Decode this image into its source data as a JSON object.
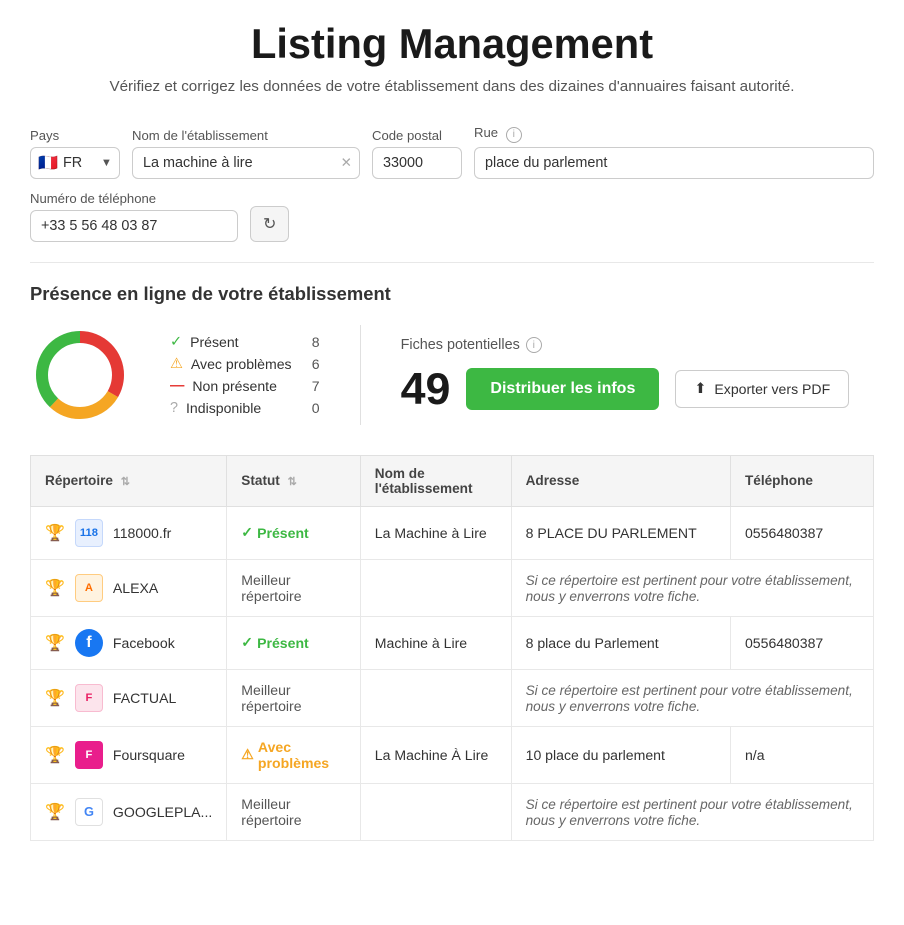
{
  "page": {
    "title": "Listing Management",
    "subtitle": "Vérifiez et corrigez les données de votre établissement dans des dizaines d'annuaires faisant autorité."
  },
  "filters": {
    "pays_label": "Pays",
    "pays_value": "FR",
    "pays_flag": "🇫🇷",
    "nom_label": "Nom de l'établissement",
    "nom_value": "La machine à lire",
    "code_postal_label": "Code postal",
    "code_postal_value": "33000",
    "rue_label": "Rue",
    "rue_info": "i",
    "rue_value": "place du parlement",
    "telephone_label": "Numéro de téléphone",
    "telephone_value": "+33 5 56 48 03 87",
    "refresh_icon": "↻"
  },
  "presence": {
    "title": "Présence en ligne de votre établissement",
    "legend": [
      {
        "label": "Présent",
        "count": 8,
        "color": "#3db843",
        "icon": "✓",
        "type": "present"
      },
      {
        "label": "Avec problèmes",
        "count": 6,
        "color": "#f5a623",
        "icon": "⚠",
        "type": "problems"
      },
      {
        "label": "Non présente",
        "count": 7,
        "color": "#e53935",
        "icon": "—",
        "type": "absent"
      },
      {
        "label": "Indisponible",
        "count": 0,
        "color": "#aaa",
        "icon": "?",
        "type": "unavailable"
      }
    ],
    "donut": {
      "present": 8,
      "problems": 6,
      "absent": 7,
      "unavailable": 0,
      "total": 21
    },
    "fiches_label": "Fiches potentielles",
    "fiches_count": "49",
    "distribute_label": "Distribuer les infos",
    "export_label": "Exporter vers PDF",
    "export_icon": "↑"
  },
  "table": {
    "headers": [
      {
        "key": "repertoire",
        "label": "Répertoire"
      },
      {
        "key": "statut",
        "label": "Statut"
      },
      {
        "key": "nom",
        "label": "Nom de l'établissement"
      },
      {
        "key": "adresse",
        "label": "Adresse"
      },
      {
        "key": "telephone",
        "label": "Téléphone"
      }
    ],
    "rows": [
      {
        "trophy": true,
        "logo_class": "logo-118",
        "logo_text": "118",
        "name": "118000.fr",
        "status_type": "present",
        "status_text": "Présent",
        "etablissement": "La Machine à Lire",
        "adresse": "8 PLACE DU PARLEMENT",
        "telephone": "0556480387"
      },
      {
        "trophy": true,
        "logo_class": "logo-alexa",
        "logo_text": "A",
        "name": "ALEXA",
        "status_type": "best",
        "status_text": "Meilleur répertoire",
        "etablissement": "",
        "adresse": "Si ce répertoire est pertinent pour votre établissement, nous y enverrons votre fiche.",
        "telephone": "",
        "is_best": true
      },
      {
        "trophy": true,
        "logo_class": "logo-fb",
        "logo_text": "f",
        "name": "Facebook",
        "status_type": "present",
        "status_text": "Présent",
        "etablissement": "Machine à Lire",
        "adresse": "8 place du Parlement",
        "telephone": "0556480387"
      },
      {
        "trophy": true,
        "logo_class": "logo-factual",
        "logo_text": "F",
        "name": "FACTUAL",
        "status_type": "best",
        "status_text": "Meilleur répertoire",
        "etablissement": "",
        "adresse": "Si ce répertoire est pertinent pour votre établissement, nous y enverrons votre fiche.",
        "telephone": "",
        "is_best": true
      },
      {
        "trophy": true,
        "logo_class": "logo-foursquare",
        "logo_text": "F",
        "name": "Foursquare",
        "status_type": "problems",
        "status_text": "Avec problèmes",
        "etablissement": "La Machine À Lire",
        "adresse": "10 place du parlement",
        "telephone": "n/a"
      },
      {
        "trophy": true,
        "logo_class": "logo-google",
        "logo_text": "G",
        "name": "GOOGLEPLA...",
        "status_type": "best",
        "status_text": "Meilleur répertoire",
        "etablissement": "",
        "adresse": "Si ce répertoire est pertinent pour votre établissement, nous y enverrons votre fiche.",
        "telephone": "",
        "is_best": true
      }
    ]
  }
}
